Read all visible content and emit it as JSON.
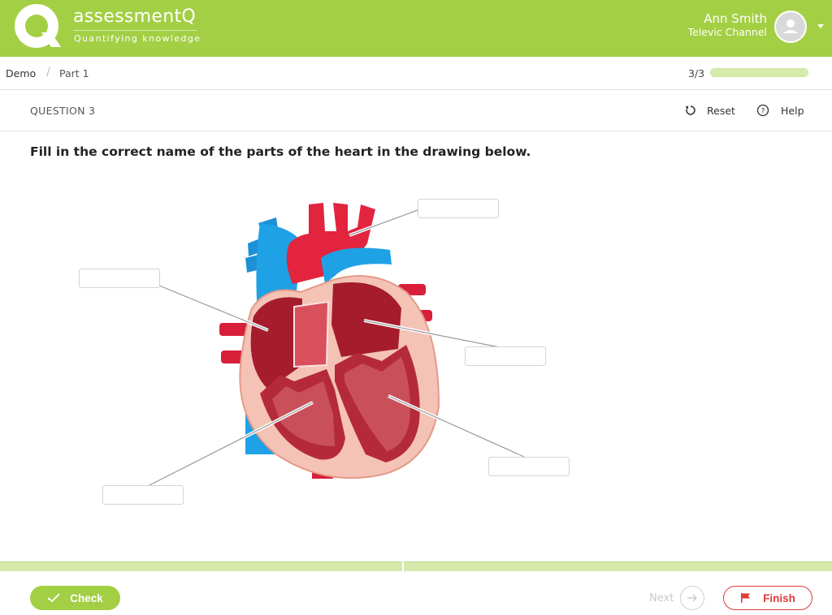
{
  "app": {
    "brand_name": "assessmentQ",
    "brand_tagline": "Quantifying knowledge",
    "accent_color": "#a3cf45",
    "danger_color": "#e03a3a"
  },
  "user": {
    "name": "Ann Smith",
    "organization": "Televic Channel",
    "avatar_icon": "user-avatar-icon",
    "menu_icon": "chevron-down-icon"
  },
  "breadcrumb": {
    "home": "Demo",
    "separator": "/",
    "current": "Part 1"
  },
  "progress": {
    "label": "3/3",
    "fraction": 1.0
  },
  "question": {
    "number_label": "QUESTION 3",
    "reset_label": "Reset",
    "reset_icon": "reset-icon",
    "help_label": "Help",
    "help_icon": "help-icon",
    "prompt": "Fill in the correct name of the parts of the heart in the drawing below."
  },
  "answers": [
    {
      "id": "top-right",
      "value": ""
    },
    {
      "id": "upper-left",
      "value": ""
    },
    {
      "id": "middle-right",
      "value": ""
    },
    {
      "id": "lower-right",
      "value": ""
    },
    {
      "id": "lower-left",
      "value": ""
    }
  ],
  "footer": {
    "check_label": "Check",
    "check_icon": "checkmark-icon",
    "next_label": "Next",
    "next_icon": "arrow-right-icon",
    "finish_label": "Finish",
    "finish_icon": "flag-icon"
  }
}
